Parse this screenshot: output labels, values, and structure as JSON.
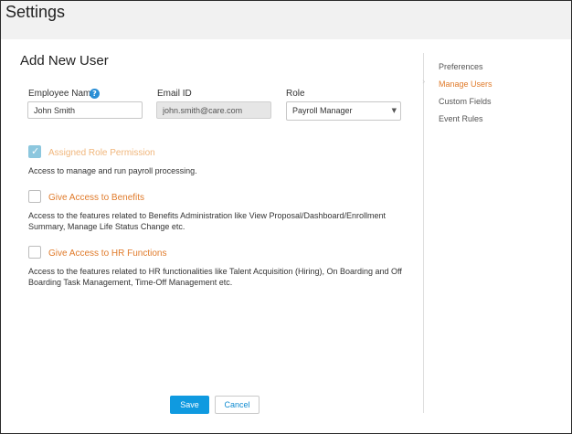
{
  "header": {
    "title": "Settings"
  },
  "form": {
    "section_title": "Add New User",
    "employee_name": {
      "label": "Employee Name",
      "value": "John Smith"
    },
    "email": {
      "label": "Email ID",
      "value": "john.smith@care.com"
    },
    "role": {
      "label": "Role",
      "value": "Payroll Manager"
    }
  },
  "permissions": [
    {
      "label": "Assigned Role Permission",
      "checked": true,
      "description": "Access to manage and run payroll processing."
    },
    {
      "label": "Give Access to Benefits",
      "checked": false,
      "description": "Access to the features related to Benefits Administration like View Proposal/Dashboard/Enrollment Summary, Manage Life Status Change etc."
    },
    {
      "label": "Give Access to HR Functions",
      "checked": false,
      "description": "Access to the features related to HR functionalities like Talent Acquisition (Hiring), On Boarding and Off Boarding Task Management, Time-Off Management etc."
    }
  ],
  "buttons": {
    "save": "Save",
    "cancel": "Cancel"
  },
  "sidebar": {
    "items": [
      {
        "label": "Preferences",
        "active": false
      },
      {
        "label": "Manage Users",
        "active": true
      },
      {
        "label": "Custom Fields",
        "active": false
      },
      {
        "label": "Event Rules",
        "active": false
      }
    ]
  },
  "icons": {
    "help": "help-circle-icon",
    "check": "checkmark-icon",
    "caret": "chevron-down-icon",
    "active": "chevron-right-icon"
  },
  "colors": {
    "accent_orange": "#e07b2b",
    "primary_blue": "#0f9ae0",
    "checked_box": "#8cc7de"
  }
}
